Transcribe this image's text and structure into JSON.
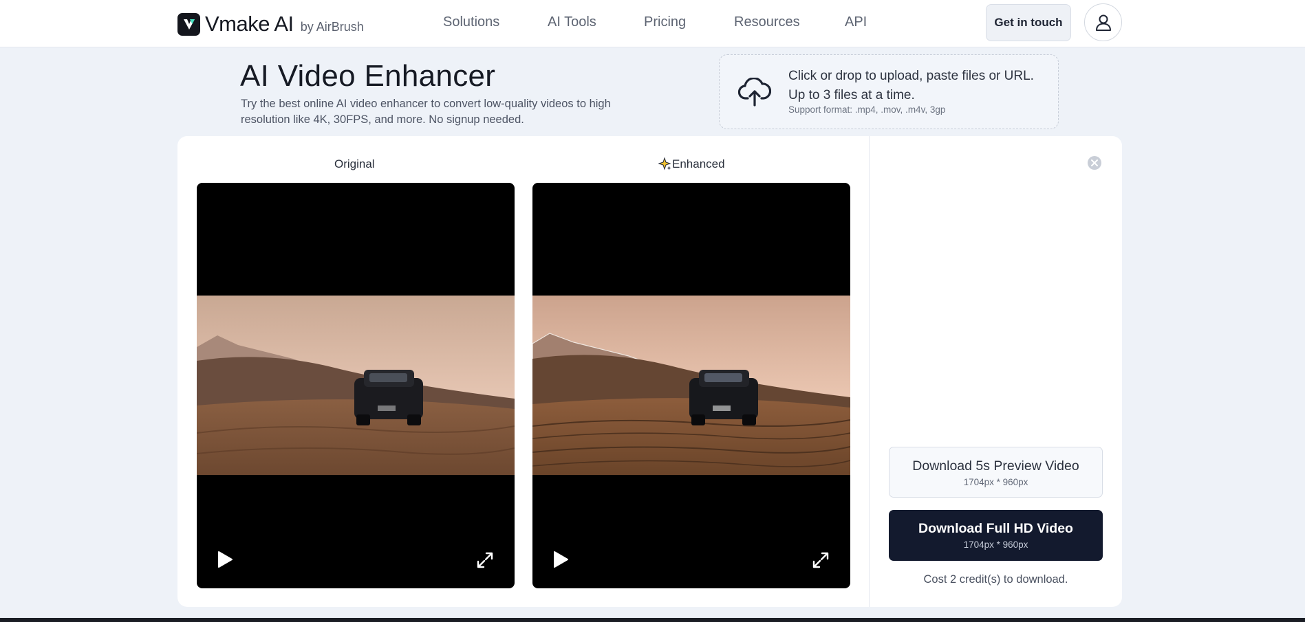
{
  "header": {
    "brand": "Vmake AI",
    "brand_suffix": "by AirBrush",
    "nav": [
      "Solutions",
      "AI Tools",
      "Pricing",
      "Resources",
      "API"
    ],
    "contact_label": "Get in touch"
  },
  "hero": {
    "title": "AI Video Enhancer",
    "description": "Try the best online AI video enhancer to convert low-quality videos to high resolution like 4K, 30FPS, and more. No signup needed."
  },
  "upload": {
    "line1": "Click or drop to upload, paste files or URL.",
    "line2": "Up to 3 files at a time.",
    "support": "Support format: .mp4, .mov, .m4v, 3gp"
  },
  "compare": {
    "original_label": "Original",
    "enhanced_label": "Enhanced"
  },
  "downloads": {
    "preview_label": "Download 5s Preview Video",
    "preview_res": "1704px * 960px",
    "full_label": "Download Full HD Video",
    "full_res": "1704px * 960px",
    "cost": "Cost 2 credit(s) to download."
  },
  "icons": {
    "logo": "vmake-logo-icon",
    "avatar": "user-icon",
    "upload": "cloud-upload-icon",
    "enhanced": "sparkle-icon",
    "play": "play-icon",
    "fullscreen": "expand-icon",
    "close": "close-icon"
  },
  "colors": {
    "primary_button": "#131a2e",
    "page_background": "#eef2f8"
  }
}
